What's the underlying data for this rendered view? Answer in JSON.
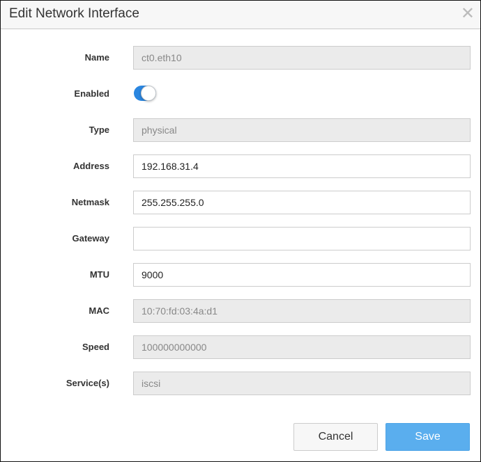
{
  "dialog": {
    "title": "Edit Network Interface",
    "close_icon": "close-icon"
  },
  "fields": {
    "name": {
      "label": "Name",
      "value": "ct0.eth10"
    },
    "enabled": {
      "label": "Enabled",
      "value": true
    },
    "type": {
      "label": "Type",
      "value": "physical"
    },
    "address": {
      "label": "Address",
      "value": "192.168.31.4"
    },
    "netmask": {
      "label": "Netmask",
      "value": "255.255.255.0"
    },
    "gateway": {
      "label": "Gateway",
      "value": ""
    },
    "mtu": {
      "label": "MTU",
      "value": "9000"
    },
    "mac": {
      "label": "MAC",
      "value": "10:70:fd:03:4a:d1"
    },
    "speed": {
      "label": "Speed",
      "value": "100000000000"
    },
    "services": {
      "label": "Service(s)",
      "value": "iscsi"
    }
  },
  "buttons": {
    "cancel": "Cancel",
    "save": "Save"
  },
  "colors": {
    "accent": "#2a86e0",
    "save": "#5aaeee"
  }
}
